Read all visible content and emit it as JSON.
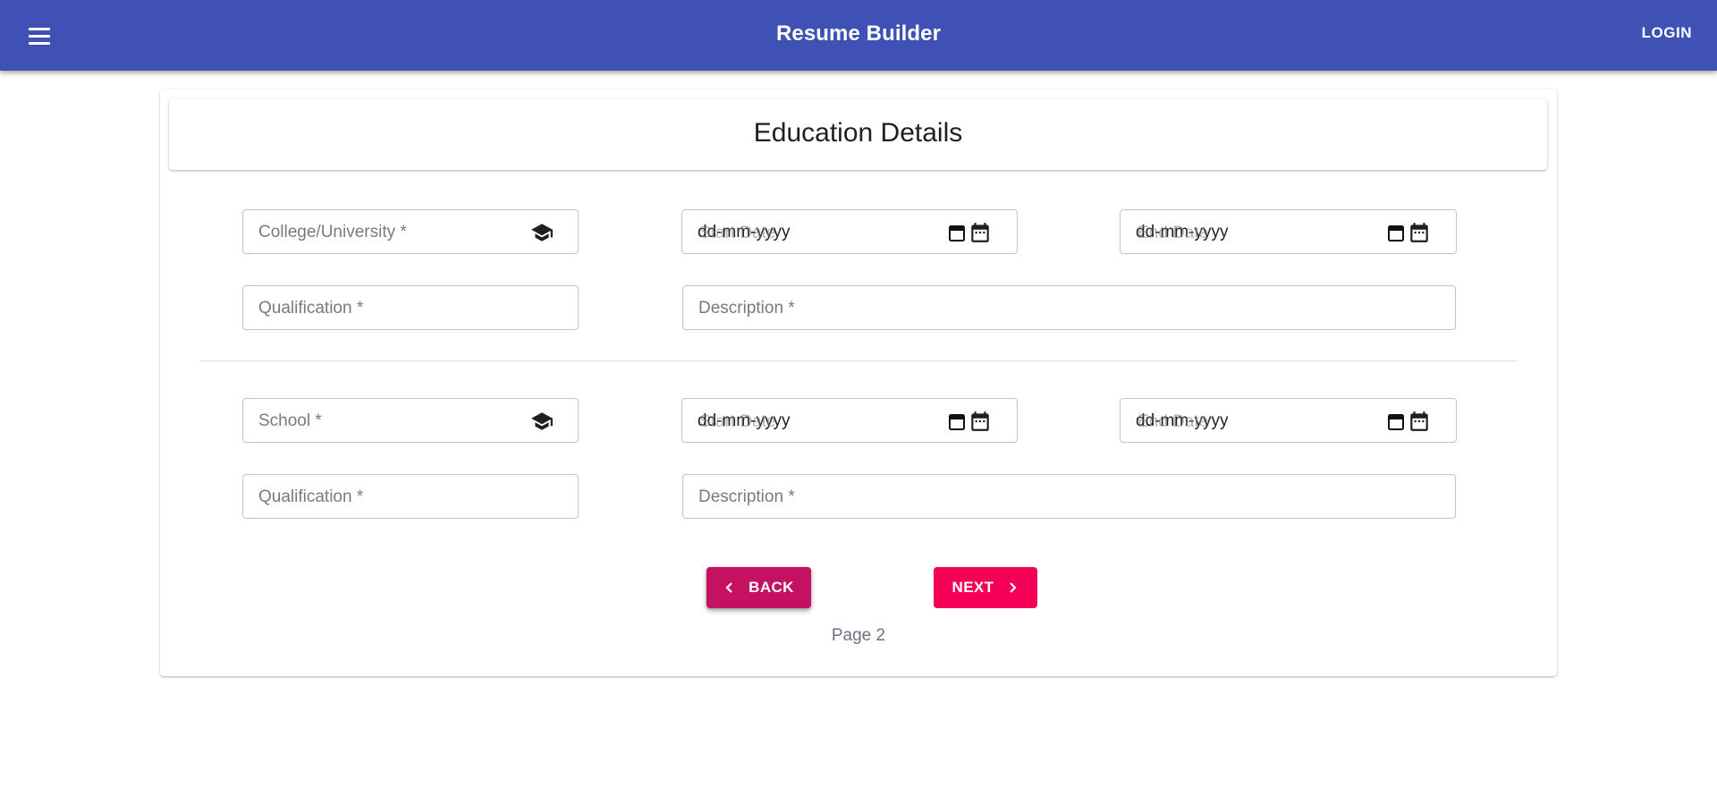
{
  "header": {
    "title": "Resume Builder",
    "login_label": "LOGIN",
    "menu_icon": "menu-icon"
  },
  "form": {
    "title": "Education Details",
    "sections": [
      {
        "institution_placeholder": "College/University *",
        "start_date_value": "dd-mm-yyyy",
        "start_date_ghost": "Start Date",
        "end_date_value": "dd-mm-yyyy",
        "end_date_ghost": "End Date",
        "qualification_placeholder": "Qualification *",
        "description_placeholder": "Description *"
      },
      {
        "institution_placeholder": "School *",
        "start_date_value": "dd-mm-yyyy",
        "start_date_ghost": "Start Date",
        "end_date_value": "dd-mm-yyyy",
        "end_date_ghost": "End Date",
        "qualification_placeholder": "Qualification *",
        "description_placeholder": "Description *"
      }
    ]
  },
  "nav": {
    "back_label": "BACK",
    "next_label": "NEXT",
    "page_label": "Page 2"
  },
  "colors": {
    "appbar": "#3f51b5",
    "back_button": "#c51162",
    "next_button": "#f50057"
  }
}
